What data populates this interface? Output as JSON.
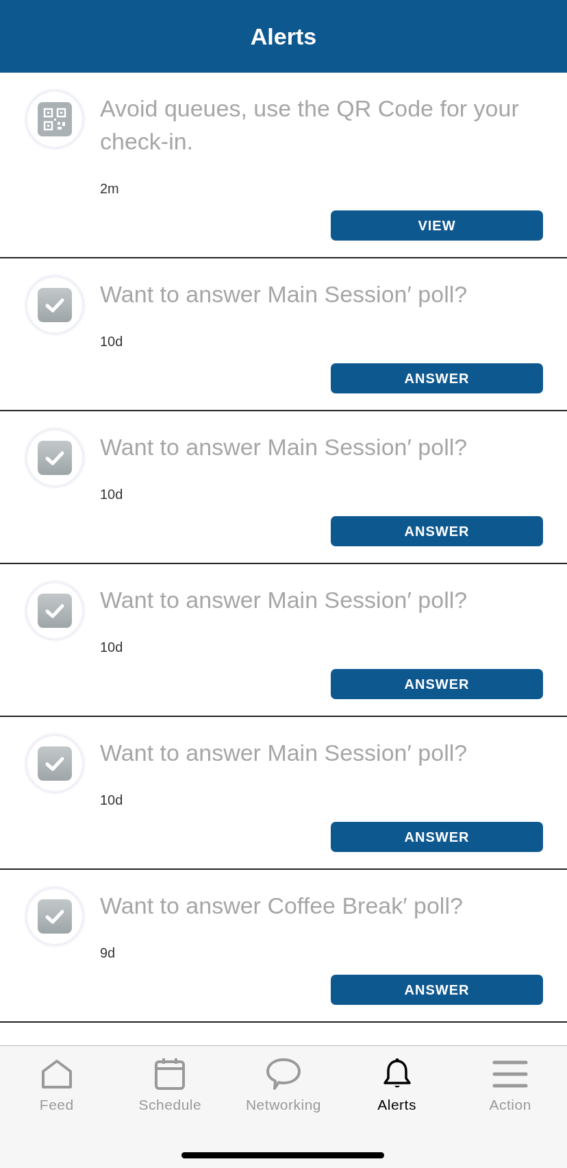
{
  "header": {
    "title": "Alerts"
  },
  "alerts": [
    {
      "kind": "qr",
      "message": "Avoid queues, use the QR Code for your check-in.",
      "time": "2m",
      "action": "VIEW"
    },
    {
      "kind": "poll",
      "message": "Want to answer Main Session′ poll?",
      "time": "10d",
      "action": "ANSWER"
    },
    {
      "kind": "poll",
      "message": "Want to answer Main Session′ poll?",
      "time": "10d",
      "action": "ANSWER"
    },
    {
      "kind": "poll",
      "message": "Want to answer Main Session′ poll?",
      "time": "10d",
      "action": "ANSWER"
    },
    {
      "kind": "poll",
      "message": "Want to answer Main Session′ poll?",
      "time": "10d",
      "action": "ANSWER"
    },
    {
      "kind": "poll",
      "message": "Want to answer Coffee Break′ poll?",
      "time": "9d",
      "action": "ANSWER"
    }
  ],
  "tab_bar": [
    {
      "label": "Feed",
      "selected": false
    },
    {
      "label": "Schedule",
      "selected": false
    },
    {
      "label": "Networking",
      "selected": false
    },
    {
      "label": "Alerts",
      "selected": true
    },
    {
      "label": "Action",
      "selected": false
    }
  ]
}
